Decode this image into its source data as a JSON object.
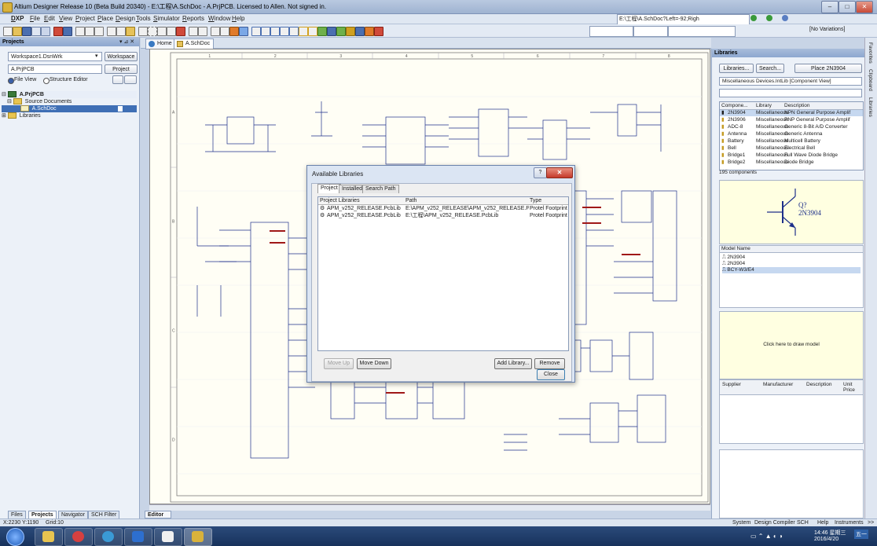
{
  "window": {
    "title": "Altium Designer Release 10 (Beta Build 20340) - E:\\工程\\A.SchDoc - A.PrjPCB. Licensed to Allen. Not signed in.",
    "controls": [
      "–",
      "□",
      "✕"
    ]
  },
  "menu": [
    "DXP",
    "File",
    "Edit",
    "View",
    "Project",
    "Place",
    "Design",
    "Tools",
    "Simulator",
    "Reports",
    "Window",
    "Help"
  ],
  "toolbar": {
    "command_path": "E:\\工程\\A.SchDoc?Left=-92;Righ",
    "variants": "[No Variations]"
  },
  "projects_panel": {
    "title": "Projects",
    "workspace_value": "Workspace1.DsnWrk",
    "workspace_button": "Workspace",
    "project_value": "A.PrjPCB",
    "project_button": "Project",
    "view_file": "File View",
    "view_structure": "Structure Editor",
    "tree": {
      "project": "A.PrjPCB",
      "source_folder": "Source Documents",
      "document": "A.SchDoc",
      "libraries_folder": "Libraries"
    },
    "bottom_tabs": [
      "Files",
      "Projects",
      "Navigator",
      "SCH Filter"
    ]
  },
  "doc_tabs": [
    "Home",
    "A.SchDoc"
  ],
  "editor_tab": "Editor",
  "sheet": {
    "columns": [
      "1",
      "2",
      "3",
      "4",
      "5",
      "6",
      "7",
      "8"
    ],
    "rows": [
      "A",
      "B",
      "C",
      "D"
    ]
  },
  "libraries_panel": {
    "title": "Libraries",
    "buttons": [
      "Libraries...",
      "Search...",
      "Place 2N3904"
    ],
    "selected_library": "Miscellaneous Devices.IntLib [Component View]",
    "table_headers": [
      "Compone...",
      "Library",
      "Description"
    ],
    "components": [
      {
        "name": "2N3904",
        "library": "Miscellaneous",
        "description": "NPN General Purpose Amplif"
      },
      {
        "name": "2N3906",
        "library": "Miscellaneous",
        "description": "PNP General Purpose Amplif"
      },
      {
        "name": "ADC-8",
        "library": "Miscellaneous",
        "description": "Generic 8-Bit A/D Converter"
      },
      {
        "name": "Antenna",
        "library": "Miscellaneous",
        "description": "Generic Antenna"
      },
      {
        "name": "Battery",
        "library": "Miscellaneous",
        "description": "Multicell Battery"
      },
      {
        "name": "Bell",
        "library": "Miscellaneous",
        "description": "Electrical Bell"
      },
      {
        "name": "Bridge1",
        "library": "Miscellaneous",
        "description": "Full Wave Diode Bridge"
      },
      {
        "name": "Bridge2",
        "library": "Miscellaneous",
        "description": "Diode Bridge"
      }
    ],
    "component_count": "195 components",
    "preview_designator": "Q?",
    "preview_comment": "2N3904",
    "model_header": "Model Name",
    "models": [
      "2N3904",
      "2N3904",
      "BCY-W3/E4"
    ],
    "draw_model": "Click here to draw model",
    "supplier_headers": [
      "Supplier",
      "Manufacturer",
      "Description",
      "Unit Price"
    ]
  },
  "side_tabs": [
    "Favorites",
    "Clipboard",
    "Libraries"
  ],
  "dialog": {
    "title": "Available Libraries",
    "help": "?",
    "close_x": "✕",
    "tabs": [
      "Project",
      "Installed",
      "Search Path"
    ],
    "headers": [
      "Project Libraries",
      "Path",
      "Type"
    ],
    "rows": [
      {
        "name": "APM_v252_RELEASE.PcbLib",
        "path": "E:\\APM_v252_RELEASE\\APM_v252_RELEASE.PcbLib",
        "type": "Protel Footprint L"
      },
      {
        "name": "APM_v252_RELEASE.PcbLib",
        "path": "E:\\工程\\APM_v252_RELEASE.PcbLib",
        "type": "Protel Footprint L"
      }
    ],
    "move_up": "Move Up",
    "move_down": "Move Down",
    "add_library": "Add Library...",
    "remove": "Remove",
    "close": "Close"
  },
  "status": {
    "coords": "X:2230 Y:1190",
    "grid": "Grid:10",
    "right_items": [
      "System",
      "Design Compiler",
      "SCH",
      "Help",
      "Instruments",
      ">>"
    ]
  },
  "taskbar": {
    "time": "14:46 星期三",
    "date": "2016/4/20",
    "lang": "五一"
  }
}
